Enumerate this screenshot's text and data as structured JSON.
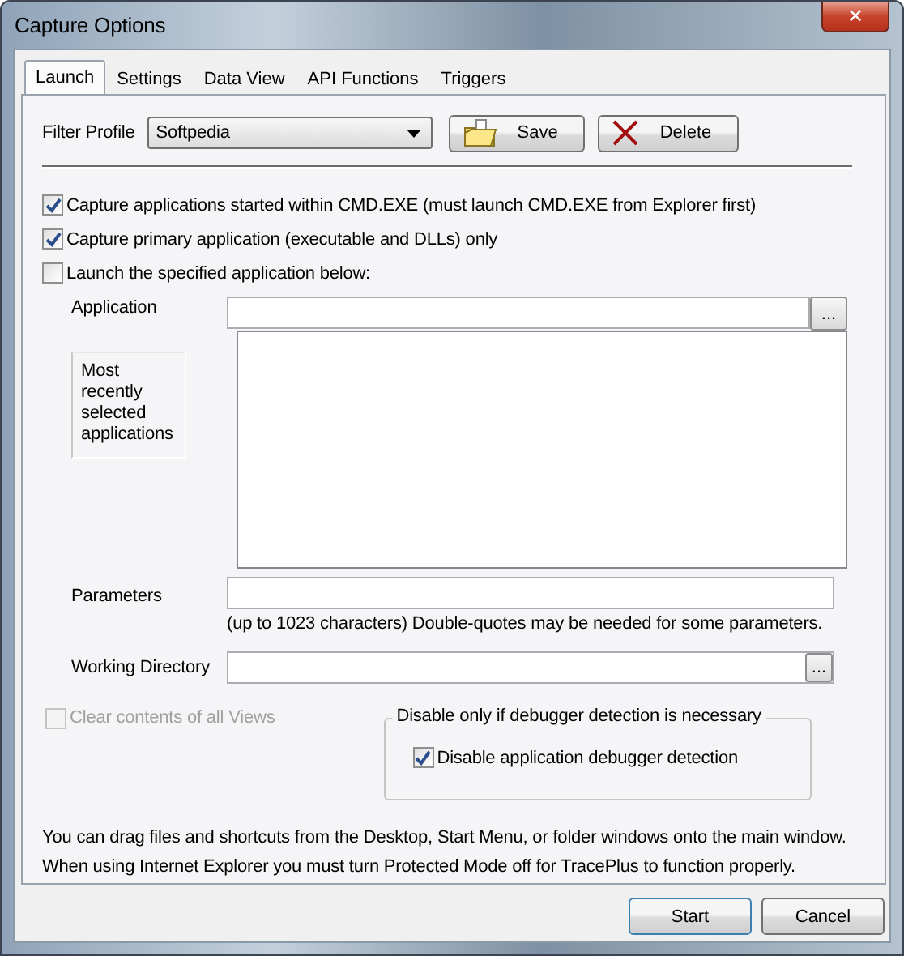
{
  "window": {
    "title": "Capture Options",
    "close": "✕"
  },
  "tabs": [
    {
      "label": "Launch",
      "selected": true
    },
    {
      "label": "Settings",
      "selected": false
    },
    {
      "label": "Data View",
      "selected": false
    },
    {
      "label": "API Functions",
      "selected": false
    },
    {
      "label": "Triggers",
      "selected": false
    }
  ],
  "filter_profile": {
    "label": "Filter Profile",
    "value": "Softpedia",
    "save": "Save",
    "delete": "Delete"
  },
  "options": [
    {
      "label": "Capture applications started within CMD.EXE (must launch CMD.EXE from Explorer first)",
      "checked": true
    },
    {
      "label": "Capture primary application (executable and DLLs) only",
      "checked": true
    },
    {
      "label": "Launch the specified application below:",
      "checked": false
    }
  ],
  "application": {
    "label": "Application",
    "browse": "..."
  },
  "recent": {
    "label": "Most recently selected applications"
  },
  "parameters": {
    "label": "Parameters",
    "hint": "(up to 1023 characters) Double-quotes may be needed for some parameters."
  },
  "working_directory": {
    "label": "Working Directory",
    "browse": "..."
  },
  "clear_views": {
    "label": "Clear contents of all Views",
    "checked": false,
    "disabled": true
  },
  "debugger_group": {
    "title": "Disable only if debugger detection is necessary",
    "option": {
      "label": "Disable application debugger detection",
      "checked": true
    }
  },
  "notes": [
    "You can drag files and shortcuts from the Desktop, Start Menu, or folder windows onto the main window.",
    "When using Internet Explorer you must turn Protected Mode off for TracePlus to function properly."
  ],
  "buttons": [
    "Start",
    "Cancel"
  ]
}
